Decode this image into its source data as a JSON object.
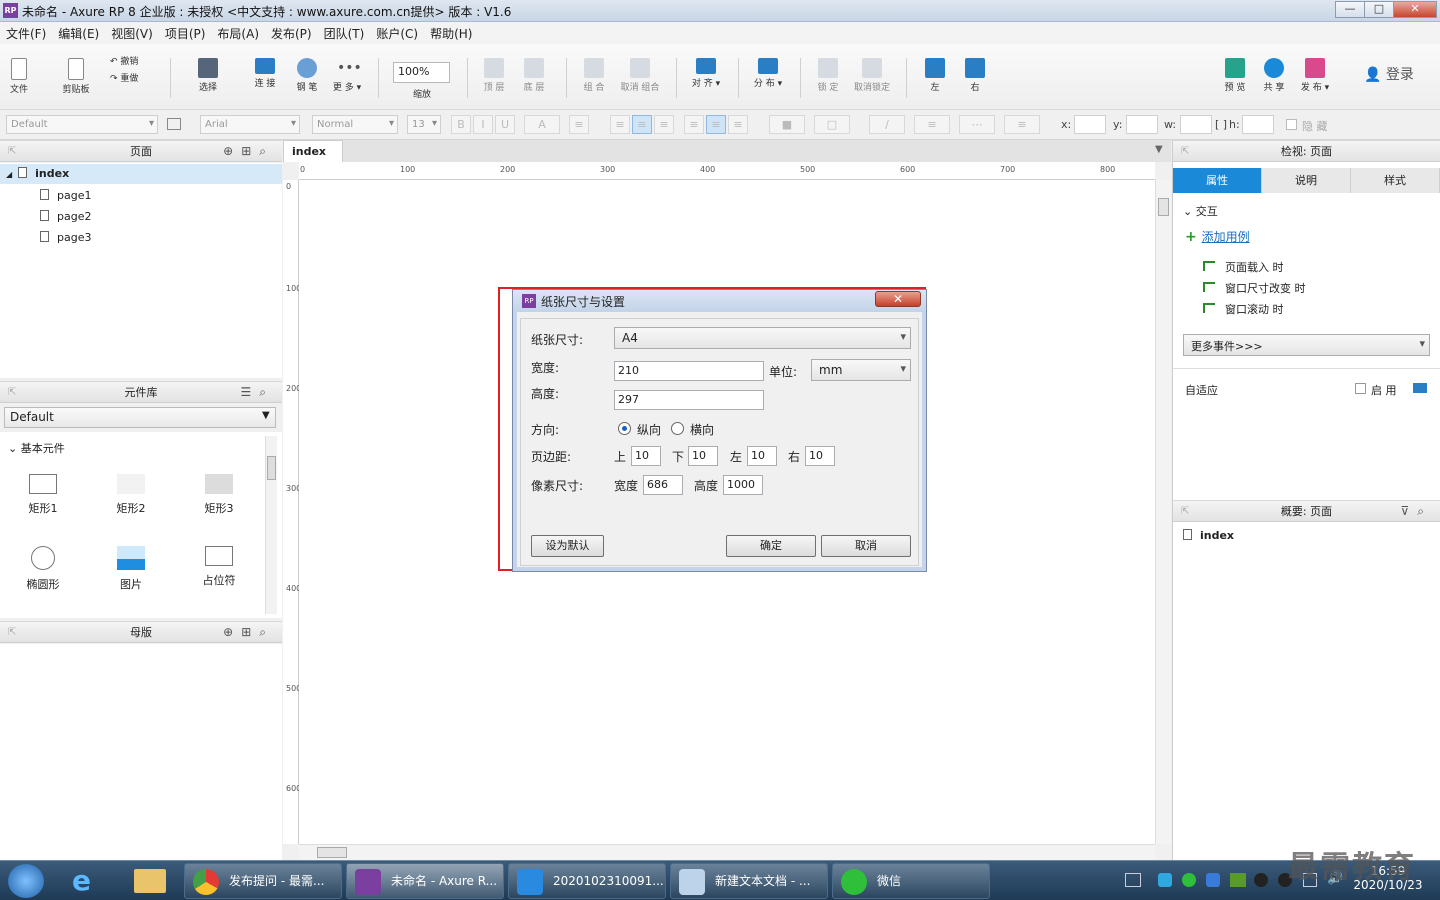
{
  "window": {
    "title": "未命名 - Axure RP 8 企业版 : 未授权     <中文支持 : www.axure.com.cn提供> 版本 : V1.6",
    "min": "—",
    "max": "□",
    "close": "✕"
  },
  "menu": [
    "文件(F)",
    "编辑(E)",
    "视图(V)",
    "项目(P)",
    "布局(A)",
    "发布(P)",
    "团队(T)",
    "账户(C)",
    "帮助(H)"
  ],
  "toolbar": {
    "file": "文件",
    "clipboard": "剪贴板",
    "undo": "撤销",
    "redo": "重做",
    "select": "选择",
    "connect": "连 接",
    "pen": "钢 笔",
    "more": "更 多 ▾",
    "zoom_value": "100%",
    "zoom": "缩放",
    "top": "顶 层",
    "bottom": "底 层",
    "group": "组 合",
    "ungroup": "取消 组合",
    "align": "对 齐 ▾",
    "distribute": "分 布 ▾",
    "lock": "锁 定",
    "unlock": "取消锁定",
    "left": "左",
    "right": "右",
    "preview": "预 览",
    "share": "共 享",
    "publish": "发 布 ▾",
    "login": "登录"
  },
  "format": {
    "style": "Default",
    "font": "Arial",
    "weight": "Normal",
    "size": "13",
    "x": "x:",
    "y": "y:",
    "w": "w:",
    "h": "h:",
    "hide": "隐 藏"
  },
  "pages_panel": {
    "title": "页面",
    "items": [
      "index",
      "page1",
      "page2",
      "page3"
    ]
  },
  "library_panel": {
    "title": "元件库",
    "select": "Default",
    "group": "基本元件",
    "widgets": [
      "矩形1",
      "矩形2",
      "矩形3",
      "椭圆形",
      "图片",
      "占位符"
    ]
  },
  "masters_panel": {
    "title": "母版"
  },
  "canvas": {
    "tab": "index",
    "tab_close": "×",
    "hticks": [
      "0",
      "100",
      "200",
      "300",
      "400",
      "500",
      "600",
      "700",
      "800"
    ],
    "vticks": [
      "0",
      "100",
      "200",
      "300",
      "400",
      "500",
      "600"
    ]
  },
  "dialog": {
    "title": "纸张尺寸与设置",
    "paper_label": "纸张尺寸:",
    "paper_value": "A4",
    "width_label": "宽度:",
    "width_value": "210",
    "unit_label": "单位:",
    "unit_value": "mm",
    "height_label": "高度:",
    "height_value": "297",
    "orient_label": "方向:",
    "portrait": "纵向",
    "landscape": "横向",
    "margin_label": "页边距:",
    "top": "上",
    "top_value": "10",
    "bottom": "下",
    "bottom_value": "10",
    "left": "左",
    "left_value": "10",
    "right": "右",
    "right_value": "10",
    "pixel_label": "像素尺寸:",
    "px_w_label": "宽度",
    "px_w_value": "686",
    "px_h_label": "高度",
    "px_h_value": "1000",
    "default_btn": "设为默认",
    "ok_btn": "确定",
    "cancel_btn": "取消"
  },
  "inspector": {
    "title": "检视: 页面",
    "tabs": [
      "属性",
      "说明",
      "样式"
    ],
    "interaction": "交互",
    "add_case": "添加用例",
    "events": [
      "页面载入 时",
      "窗口尺寸改变 时",
      "窗口滚动 时"
    ],
    "more_events": "更多事件>>>",
    "adaptive": "自适应",
    "enable": "启 用"
  },
  "outline": {
    "title": "概要: 页面",
    "item": "index"
  },
  "taskbar": {
    "items": [
      "发布提问 - 最需...",
      "未命名 - Axure R...",
      "2020102310091...",
      "新建文本文档 - ...",
      "微信"
    ],
    "time": "16:59",
    "date": "2020/10/23"
  },
  "watermark": "最需教育",
  "colors": {
    "accent": "#1a8ad8",
    "highlight": "#e02020",
    "brand": "#7b3fa0"
  }
}
